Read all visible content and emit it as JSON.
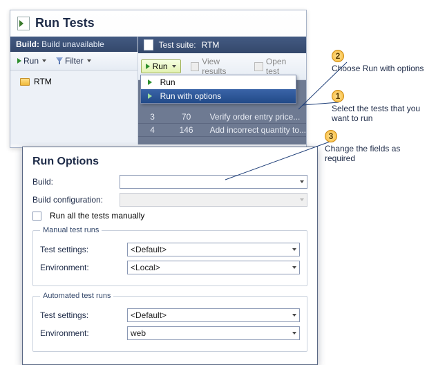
{
  "title": "Run Tests",
  "build_bar": {
    "label": "Build:",
    "value": "Build unavailable"
  },
  "left_toolbar": {
    "run": "Run",
    "filter": "Filter"
  },
  "tree": {
    "item1": "RTM"
  },
  "suite_header": {
    "label": "Test suite:",
    "name": "RTM"
  },
  "suite_toolbar": {
    "run": "Run",
    "view_results": "View results",
    "open_test": "Open test"
  },
  "run_menu": {
    "item1": "Run",
    "item2": "Run with options"
  },
  "grid": {
    "rows": [
      {
        "c1": "3",
        "c2": "70",
        "c3": "Verify order entry price..."
      },
      {
        "c1": "4",
        "c2": "146",
        "c3": "Add incorrect quantity to..."
      }
    ]
  },
  "run_options": {
    "title": "Run Options",
    "build_label": "Build:",
    "build_value": "",
    "build_cfg_label": "Build configuration:",
    "build_cfg_value": "",
    "chk_label": "Run all the tests manually",
    "manual_legend": "Manual test runs",
    "auto_legend": "Automated test runs",
    "settings_label": "Test settings:",
    "env_label": "Environment:",
    "manual_settings": "<Default>",
    "manual_env": "<Local>",
    "auto_settings": "<Default>",
    "auto_env": "web"
  },
  "callouts": {
    "c1": {
      "num": "1",
      "text": "Select the tests that you want to run"
    },
    "c2": {
      "num": "2",
      "text": "Choose Run with options"
    },
    "c3": {
      "num": "3",
      "text": "Change the fields as required"
    }
  }
}
